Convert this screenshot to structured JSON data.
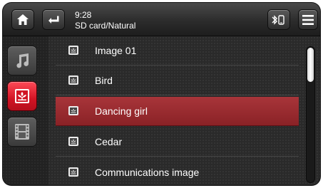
{
  "status": {
    "time": "9:28",
    "location": "SD card/Natural"
  },
  "toolbar": {
    "home_icon": "home-icon",
    "back_icon": "back-arrow-icon",
    "bluetooth_icon": "bluetooth-icon",
    "menu_icon": "menu-icon"
  },
  "sidebar": {
    "items": [
      {
        "icon": "music-note-icon",
        "active": false
      },
      {
        "icon": "picture-icon",
        "active": true
      },
      {
        "icon": "film-icon",
        "active": false
      }
    ]
  },
  "list": {
    "items": [
      {
        "label": "Image 01",
        "selected": false
      },
      {
        "label": "Bird",
        "selected": false
      },
      {
        "label": "Dancing girl",
        "selected": true
      },
      {
        "label": "Cedar",
        "selected": false
      },
      {
        "label": "Communications image",
        "selected": false
      }
    ]
  },
  "scroll": {
    "position_fraction": 0.0
  },
  "colors": {
    "accent": "#d11424",
    "selected_row": "#8a2226",
    "background": "#2a2a2a"
  }
}
